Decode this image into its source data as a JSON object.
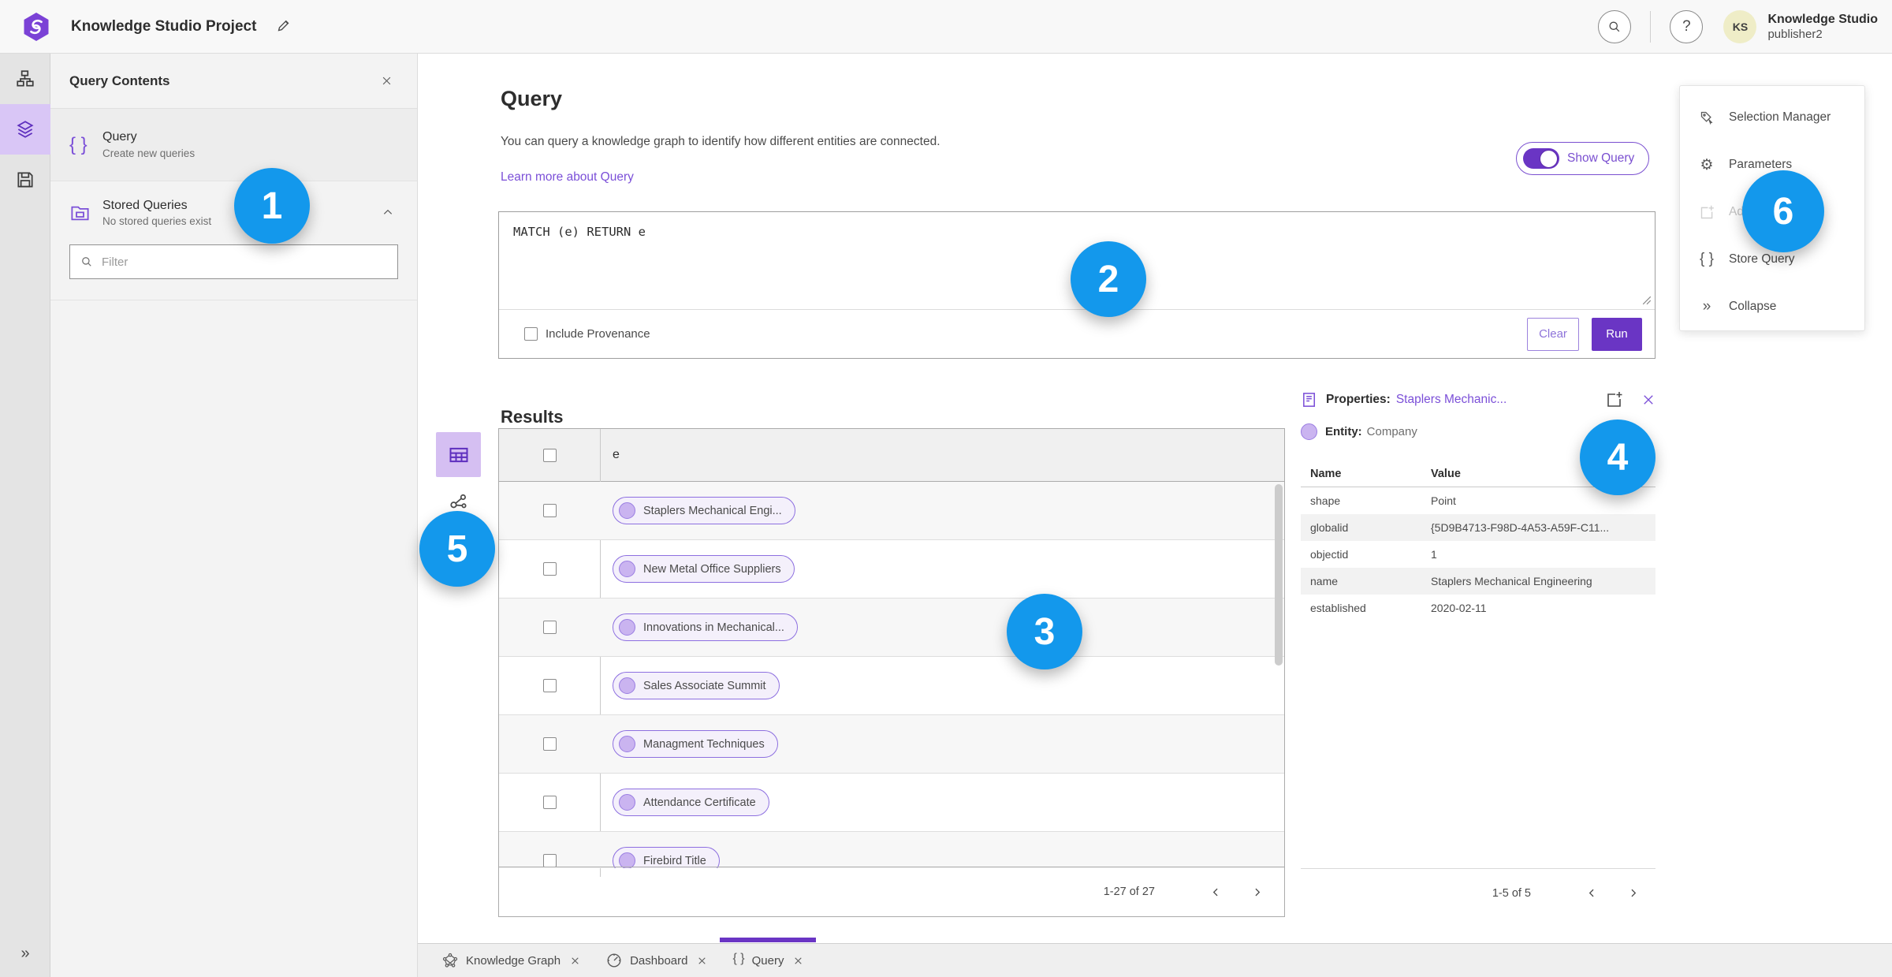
{
  "topbar": {
    "title": "Knowledge Studio Project",
    "avatar": "KS",
    "account_name": "Knowledge Studio",
    "account_user": "publisher2"
  },
  "icons": {
    "braces": "{ }",
    "gear": "⚙",
    "double_chevron_right": "»",
    "question": "?"
  },
  "contents_panel": {
    "title": "Query Contents",
    "query": {
      "title": "Query",
      "subtitle": "Create new queries"
    },
    "stored": {
      "title": "Stored Queries",
      "subtitle": "No stored queries exist"
    },
    "filter_placeholder": "Filter"
  },
  "query_section": {
    "title": "Query",
    "description": "You can query a knowledge graph to identify how different entities are connected.",
    "learn_more": "Learn more about Query",
    "show_query": "Show Query",
    "query_text": "MATCH (e) RETURN e",
    "include_provenance": "Include Provenance",
    "clear": "Clear",
    "run": "Run"
  },
  "results": {
    "title": "Results",
    "column": "e",
    "rows": [
      "Staplers Mechanical Engi...",
      "New Metal Office Suppliers",
      "Innovations in Mechanical...",
      "Sales Associate Summit",
      "Managment Techniques",
      "Attendance Certificate",
      "Firebird Title"
    ],
    "pagination": "1-27 of 27"
  },
  "properties": {
    "label": "Properties:",
    "entity_link": "Staplers Mechanic...",
    "entity_label": "Entity:",
    "entity_type": "Company",
    "columns": {
      "name": "Name",
      "value": "Value"
    },
    "rows": [
      {
        "name": "shape",
        "value": "Point"
      },
      {
        "name": "globalid",
        "value": "{5D9B4713-F98D-4A53-A59F-C11..."
      },
      {
        "name": "objectid",
        "value": "1"
      },
      {
        "name": "name",
        "value": "Staplers Mechanical Engineering"
      },
      {
        "name": "established",
        "value": "2020-02-11"
      }
    ],
    "pagination": "1-5 of 5"
  },
  "right_menu": {
    "selection_manager": "Selection Manager",
    "parameters": "Parameters",
    "add": "Add",
    "store_query": "Store Query",
    "collapse": "Collapse"
  },
  "tabs": {
    "knowledge_graph": "Knowledge Graph",
    "dashboard": "Dashboard",
    "query": "Query"
  },
  "badges": {
    "b1": "1",
    "b2": "2",
    "b3": "3",
    "b4": "4",
    "b5": "5",
    "b6": "6"
  },
  "colors": {
    "accent": "#6a35c4",
    "badge_blue": "#1398ec",
    "chip_border": "#8d6fe0"
  }
}
